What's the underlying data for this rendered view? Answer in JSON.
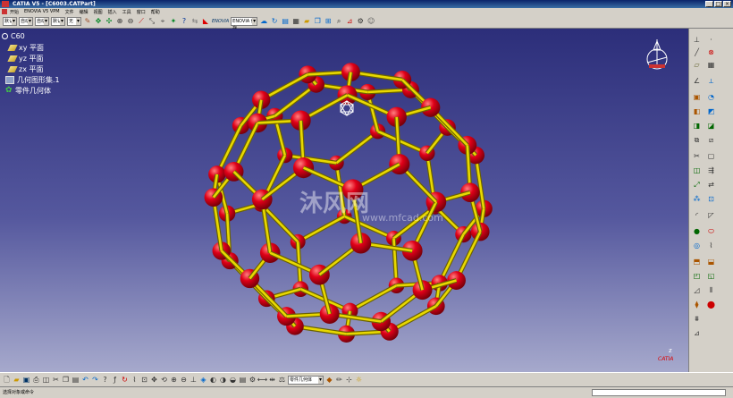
{
  "window": {
    "title": "CATIA V5 - [C6003.CATPart]"
  },
  "menu": [
    "开始",
    "ENOVIA V5 VPM",
    "文件",
    "编辑",
    "视图",
    "插入",
    "工具",
    "窗口",
    "帮助"
  ],
  "top_toolbar": {
    "combos": [
      "默认",
      "自动",
      "自动",
      "默认",
      "无"
    ],
    "enovia_label": "ENOVIA",
    "enovia_button": "ENOVIA 保存"
  },
  "tree": {
    "root": "C60",
    "items": [
      "xy 平面",
      "yz 平面",
      "zx 平面",
      "几何图形集.1",
      "零件几何体"
    ]
  },
  "watermark": {
    "main": "沐风网",
    "sub": "www.mfcad.com"
  },
  "bottom_toolbar": {
    "combo": "零件几何体"
  },
  "status": {
    "message": "选择对象或命令"
  },
  "axis_label": "z",
  "brand": "CATIA",
  "colors": {
    "atom": "#e00018",
    "bond": "#e8d800",
    "bg_top": "#2c2e7a",
    "bg_bottom": "#a6a9cc"
  }
}
